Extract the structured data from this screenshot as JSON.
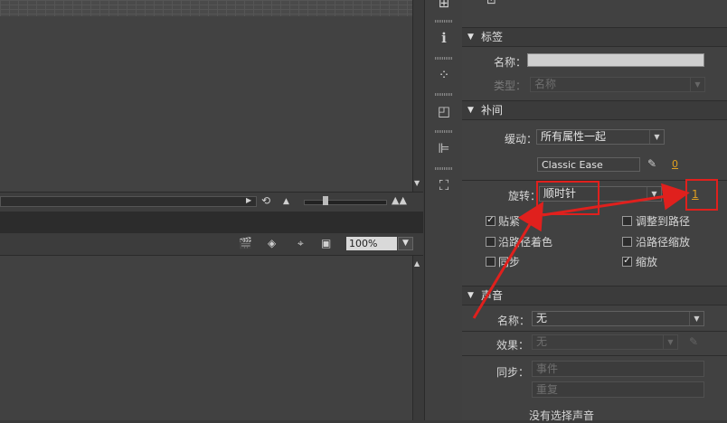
{
  "timeline": {
    "zoom": {
      "value": "100%",
      "options_arrow": "▼"
    }
  },
  "icon_column": {
    "icons": [
      {
        "name": "align-grid-icon",
        "glyph": "⊞"
      },
      {
        "name": "info-icon",
        "glyph": "ℹ"
      },
      {
        "name": "swatches-icon",
        "glyph": "⁘"
      },
      {
        "name": "transform-icon",
        "glyph": "◰"
      },
      {
        "name": "align-icon",
        "glyph": "⊫"
      },
      {
        "name": "free-transform-icon",
        "glyph": "⛶"
      }
    ]
  },
  "properties": {
    "label_section": {
      "title": "标签",
      "name_label": "名称：",
      "name_value": "",
      "type_label": "类型：",
      "type_value": "名称"
    },
    "tween_section": {
      "title": "补间",
      "ease_label": "缓动：",
      "ease_value": "所有属性一起",
      "classic_ease": "Classic Ease",
      "ease_amount": "0",
      "rotate_label": "旋转：",
      "rotate_value": "顺时针",
      "rotate_times": "1",
      "checkboxes": [
        {
          "label": "贴紧",
          "checked": true
        },
        {
          "label": "调整到路径",
          "checked": false
        },
        {
          "label": "沿路径着色",
          "checked": false
        },
        {
          "label": "沿路径缩放",
          "checked": false
        },
        {
          "label": "同步",
          "checked": false
        },
        {
          "label": "缩放",
          "checked": true
        }
      ]
    },
    "sound_section": {
      "title": "声音",
      "name_label": "名称：",
      "name_value": "无",
      "effect_label": "效果：",
      "effect_value": "无",
      "sync_label": "同步：",
      "sync_value": "事件",
      "repeat_value": "重复",
      "no_sound": "没有选择声音"
    }
  },
  "annotations": {
    "color": "#e0201d"
  }
}
